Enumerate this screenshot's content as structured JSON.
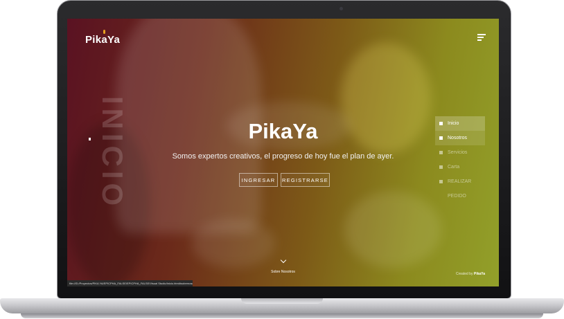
{
  "header": {
    "brand": "PikaYa"
  },
  "hero": {
    "side_word": "INICIO",
    "title": "PikaYa",
    "subtitle": "Somos expertos creativos, el progreso de hoy fue el plan de ayer.",
    "login_label": "INGRESAR",
    "register_label": "REGISTRARSE"
  },
  "nav": {
    "items": [
      {
        "label": "Inicio",
        "icon": "home-icon"
      },
      {
        "label": "Nosotros",
        "icon": "star-icon"
      },
      {
        "label": "Servicios",
        "icon": "clipboard-icon"
      },
      {
        "label": "Carta",
        "icon": "card-icon"
      },
      {
        "label": "REALIZAR PEDIDO",
        "icon": "order-icon"
      }
    ]
  },
  "footer": {
    "about_label": "Sobre Nosotros",
    "created_prefix": "Created by",
    "created_brand": "PikaYa",
    "status_url": "file:///D:/Proyectos/PIKA YA/EPICPHA_FALSE/EPICPHA_FALSE/Visual Studio/Inicio.html#sobrenosotros"
  },
  "colors": {
    "gradient_start": "#5a1222",
    "gradient_end": "#92a02a"
  }
}
